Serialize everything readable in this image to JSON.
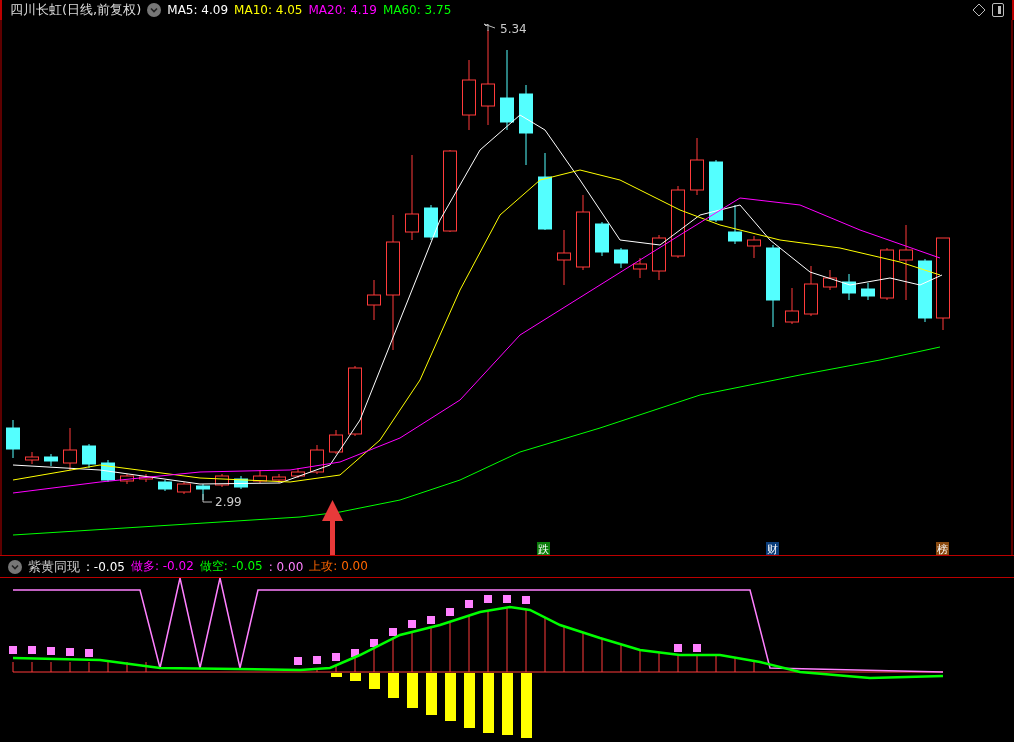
{
  "title": "四川长虹(日线,前复权)",
  "moving_averages": [
    {
      "label": "MA5: 4.09",
      "color": "#ffffff"
    },
    {
      "label": "MA10: 4.05",
      "color": "#ffff00"
    },
    {
      "label": "MA20: 4.19",
      "color": "#ff00ff"
    },
    {
      "label": "MA60: 3.75",
      "color": "#00ff00"
    }
  ],
  "high_label": "5.34",
  "low_label": "2.99",
  "events": [
    {
      "label": "跌",
      "color": "#0a7d0a"
    },
    {
      "label": "财",
      "color": "#0b3d7a"
    },
    {
      "label": "榜",
      "color": "#8a4a10"
    }
  ],
  "indicator": {
    "name": "紫黄同现",
    "values": [
      {
        "text": ": -0.05",
        "color": "#ffffff"
      },
      {
        "text": "做多: -0.02",
        "color": "#ff00ff"
      },
      {
        "text": "做空: -0.05",
        "color": "#00ff00"
      },
      {
        "text": ": 0.00",
        "color": "#ff80ff"
      },
      {
        "text": "上攻: 0.00",
        "color": "#ff6600"
      }
    ]
  }
}
